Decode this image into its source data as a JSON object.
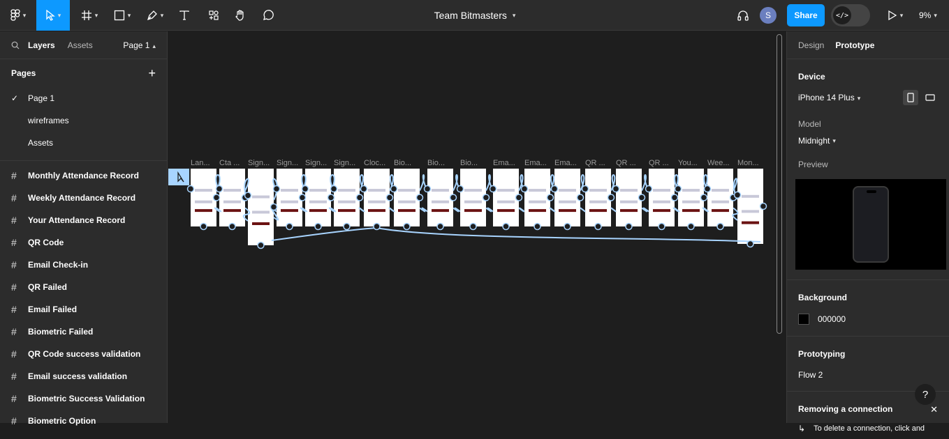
{
  "toolbar": {
    "file_title": "Team Bitmasters",
    "avatar_initial": "S",
    "share_label": "Share",
    "devmode_label": "</>",
    "zoom": "9%"
  },
  "left_panel": {
    "tabs": {
      "layers": "Layers",
      "assets": "Assets",
      "page_selector": "Page 1"
    },
    "pages_title": "Pages",
    "pages": [
      "Page 1",
      "wireframes",
      "Assets"
    ],
    "layers": [
      "Monthly Attendance Record",
      "Weekly Attendance Record",
      "Your Attendance Record",
      "QR Code",
      "Email Check-in",
      "QR Failed",
      "Email Failed",
      "Biometric Failed",
      "QR Code success validation",
      "Email success validation",
      "Biometric Success Validation",
      "Biometric Option"
    ]
  },
  "canvas": {
    "frame_labels": [
      "Lan...",
      "Cta ...",
      "Sign...",
      "Sign...",
      "Sign...",
      "Sign...",
      "Cloc...",
      "Bio...",
      "Bio...",
      "Bio...",
      "Ema...",
      "Ema...",
      "Ema...",
      "QR ...",
      "QR ...",
      "QR ...",
      "You...",
      "Wee...",
      "Mon..."
    ]
  },
  "right_panel": {
    "tabs": {
      "design": "Design",
      "prototype": "Prototype"
    },
    "device_title": "Device",
    "device": "iPhone 14 Plus",
    "model_label": "Model",
    "model": "Midnight",
    "preview_label": "Preview",
    "background_title": "Background",
    "background_value": "000000",
    "prototyping_title": "Prototyping",
    "flow": "Flow 2",
    "removing_title": "Removing a connection",
    "removing_text": "To delete a connection, click and"
  },
  "colors": {
    "accent": "#0d99ff",
    "panel": "#2c2c2c",
    "canvas": "#1e1e1e",
    "connector": "#a8d4ff"
  }
}
